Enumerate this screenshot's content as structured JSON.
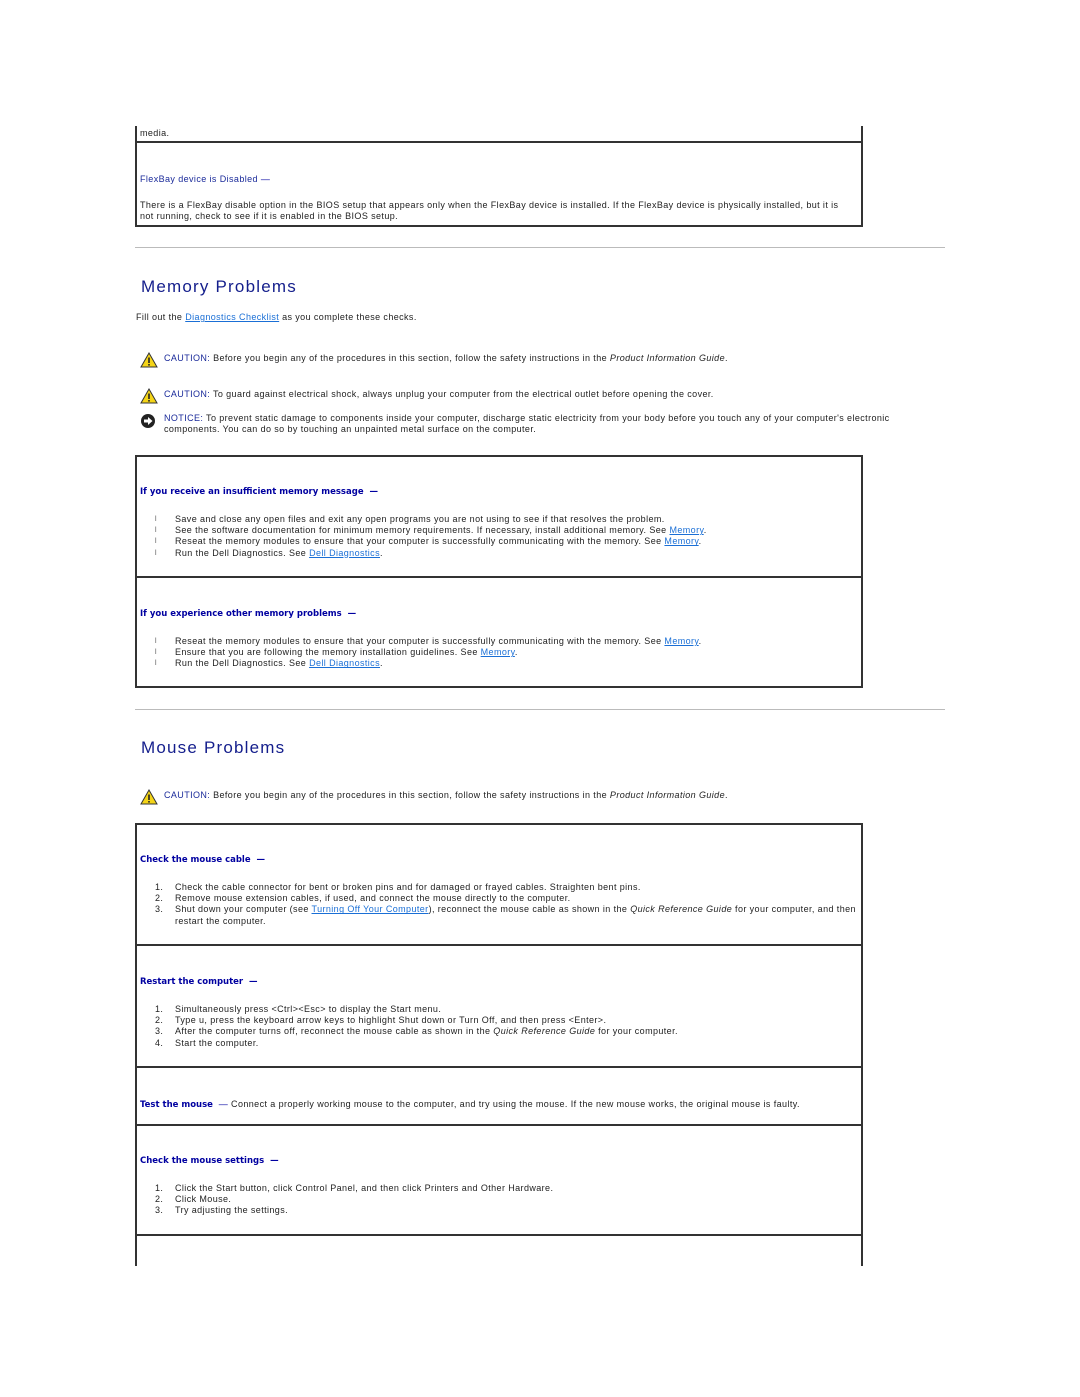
{
  "top_fragment": {
    "tail_text": "media.",
    "flexbay_heading": "FlexBay device is Disabled",
    "flexbay_text": "There is a FlexBay disable option in the BIOS setup that appears only when the FlexBay device is installed. If the FlexBay device is physically installed, but it is not running, check to see if it is enabled in the BIOS setup."
  },
  "dash": "—",
  "memory": {
    "title": "Memory Problems",
    "intro_before": "Fill out the ",
    "intro_link": "Diagnostics Checklist",
    "intro_after": " as you complete these checks.",
    "caution1": {
      "label": "CAUTION:",
      "text": " Before you begin any of the procedures in this section, follow the safety instructions in the ",
      "italic": "Product Information Guide",
      "end": "."
    },
    "caution2": {
      "label": "CAUTION:",
      "text": " To guard against electrical shock, always unplug your computer from the electrical outlet before opening the cover."
    },
    "notice": {
      "label": "NOTICE:",
      "text": " To prevent static damage to components inside your computer, discharge static electricity from your body before you touch any of your computer's electronic components. You can do so by touching an unpainted metal surface on the computer."
    },
    "block1": {
      "heading": "If you receive an insufficient memory message",
      "items": [
        {
          "text": "Save and close any open files and exit any open programs you are not using to see if that resolves the problem.",
          "link": "",
          "end": ""
        },
        {
          "text": "See the software documentation for minimum memory requirements. If necessary, install additional memory. See ",
          "link": "Memory",
          "end": "."
        },
        {
          "text": "Reseat the memory modules to ensure that your computer is successfully communicating with the memory. See ",
          "link": "Memory",
          "end": "."
        },
        {
          "text": "Run the Dell Diagnostics. See ",
          "link": "Dell Diagnostics",
          "end": "."
        }
      ]
    },
    "block2": {
      "heading": "If you experience other memory problems",
      "items": [
        {
          "text": "Reseat the memory modules to ensure that your computer is successfully communicating with the memory. See ",
          "link": "Memory",
          "end": "."
        },
        {
          "text": "Ensure that you are following the memory installation guidelines. See ",
          "link": "Memory",
          "end": "."
        },
        {
          "text": "Run the Dell Diagnostics. See ",
          "link": "Dell Diagnostics",
          "end": "."
        }
      ]
    }
  },
  "mouse": {
    "title": "Mouse Problems",
    "caution": {
      "label": "CAUTION:",
      "text": " Before you begin any of the procedures in this section, follow the safety instructions in the ",
      "italic": "Product Information Guide",
      "end": "."
    },
    "cable": {
      "heading": "Check the mouse cable",
      "items": [
        {
          "num": "1.",
          "text": "Check the cable connector for bent or broken pins and for damaged or frayed cables. Straighten bent pins."
        },
        {
          "num": "2.",
          "text": "Remove mouse extension cables, if used, and connect the mouse directly to the computer."
        },
        {
          "num": "3.",
          "pre": "Shut down your computer (see ",
          "link": "Turning Off Your Computer",
          "mid": "), reconnect the mouse cable as shown in the ",
          "italic": "Quick Reference Guide",
          "post": " for your computer, and then restart the computer."
        }
      ]
    },
    "restart": {
      "heading": "Restart the computer",
      "items": [
        {
          "num": "1.",
          "text": "Simultaneously press <Ctrl><Esc> to display the Start menu."
        },
        {
          "num": "2.",
          "text": "Type u, press the keyboard arrow keys to highlight Shut down or Turn Off, and then press <Enter>."
        },
        {
          "num": "3.",
          "pre": "After the computer turns off, reconnect the mouse cable as shown in the ",
          "italic": "Quick Reference Guide",
          "post": " for your computer."
        },
        {
          "num": "4.",
          "text": "Start the computer."
        }
      ]
    },
    "test": {
      "heading": "Test the mouse",
      "text": " Connect a properly working mouse to the computer, and try using the mouse. If the new mouse works, the original mouse is faulty."
    },
    "settings": {
      "heading": "Check the mouse settings",
      "items": [
        {
          "num": "1.",
          "text": "Click the Start button, click Control Panel, and then click Printers and Other Hardware."
        },
        {
          "num": "2.",
          "text": "Click Mouse."
        },
        {
          "num": "3.",
          "text": "Try adjusting the settings."
        }
      ]
    }
  }
}
